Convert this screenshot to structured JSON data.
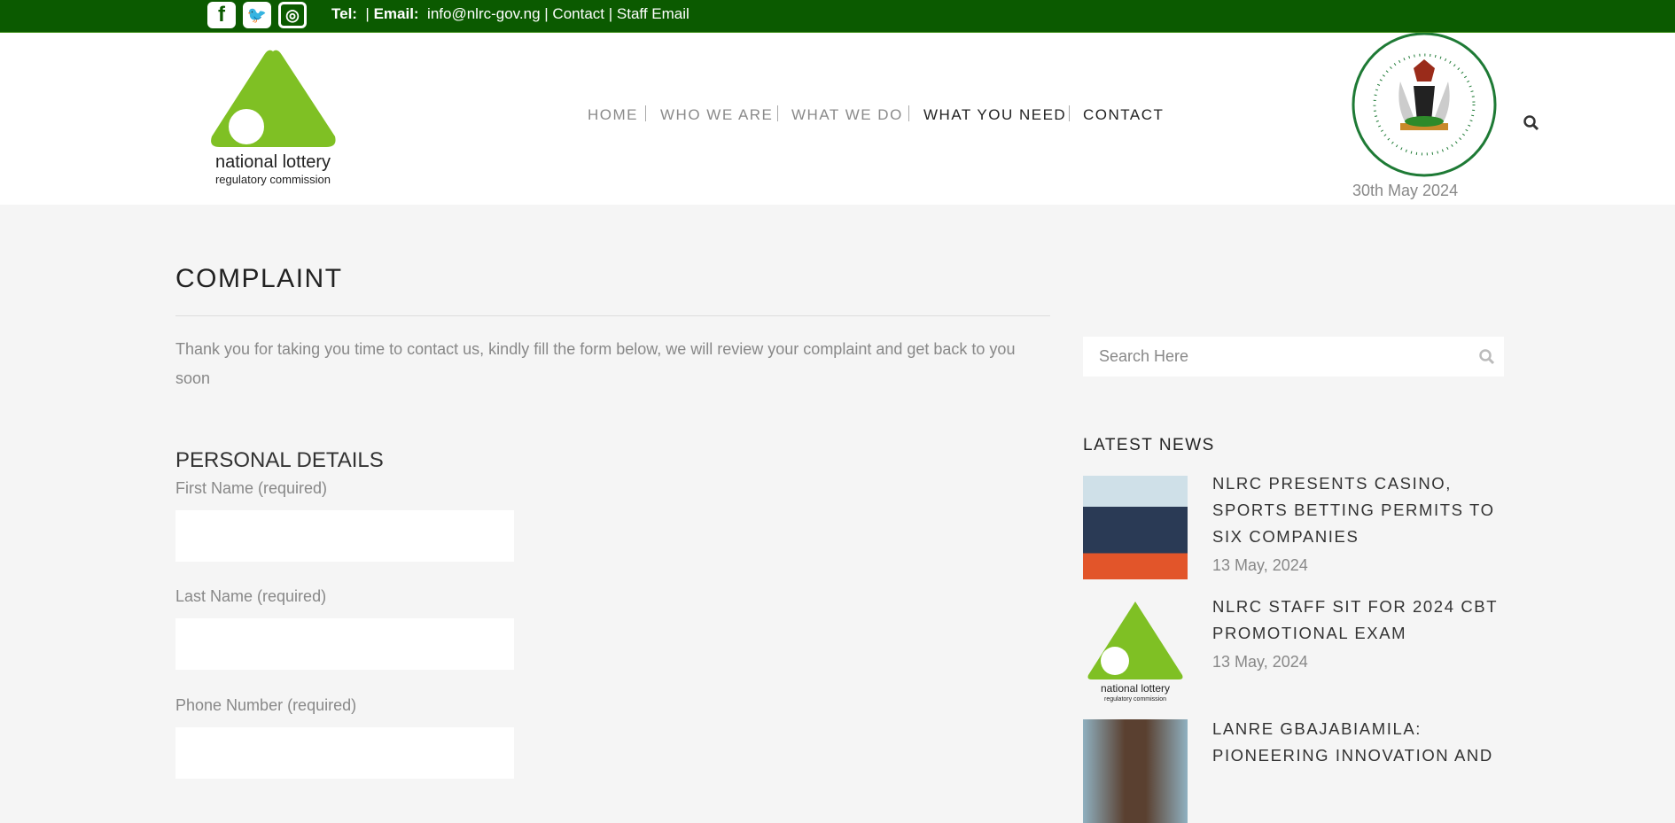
{
  "topbar": {
    "social": [
      "facebook-icon",
      "twitter-icon",
      "instagram-icon"
    ],
    "tel_label": "Tel:",
    "email_label": "Email:",
    "email": "info@nlrc-gov.ng",
    "contact": "Contact",
    "staff_email": "Staff Email",
    "color": "#0b5a00"
  },
  "header": {
    "logo_line1": "national lottery",
    "logo_line2": "regulatory commission",
    "nav": [
      "HOME",
      "WHO WE ARE",
      "WHAT WE DO",
      "WHAT YOU NEED",
      "CONTACT"
    ],
    "seal_text": "SEAL OF THE PRESIDENT OF THE FEDERAL REPUBLIC OF NIGERIA",
    "date": "30th May 2024"
  },
  "main": {
    "title": "COMPLAINT",
    "intro": "Thank you for taking you time to contact us, kindly fill the form below, we will review your complaint and get back to you soon",
    "section": "PERSONAL DETAILS",
    "fields": [
      {
        "label": "First Name (required)",
        "value": ""
      },
      {
        "label": "Last Name (required)",
        "value": ""
      },
      {
        "label": "Phone Number (required)",
        "value": ""
      }
    ]
  },
  "sidebar": {
    "search_placeholder": "Search Here",
    "news_heading": "LATEST NEWS",
    "news": [
      {
        "title": "NLRC PRESENTS CASINO, SPORTS BETTING PERMITS TO SIX COMPANIES",
        "date": "13 May, 2024"
      },
      {
        "title": "NLRC STAFF SIT FOR 2024 CBT PROMOTIONAL EXAM",
        "date": "13 May, 2024"
      },
      {
        "title": "LANRE GBAJABIAMILA: PIONEERING INNOVATION AND",
        "date": ""
      }
    ]
  }
}
